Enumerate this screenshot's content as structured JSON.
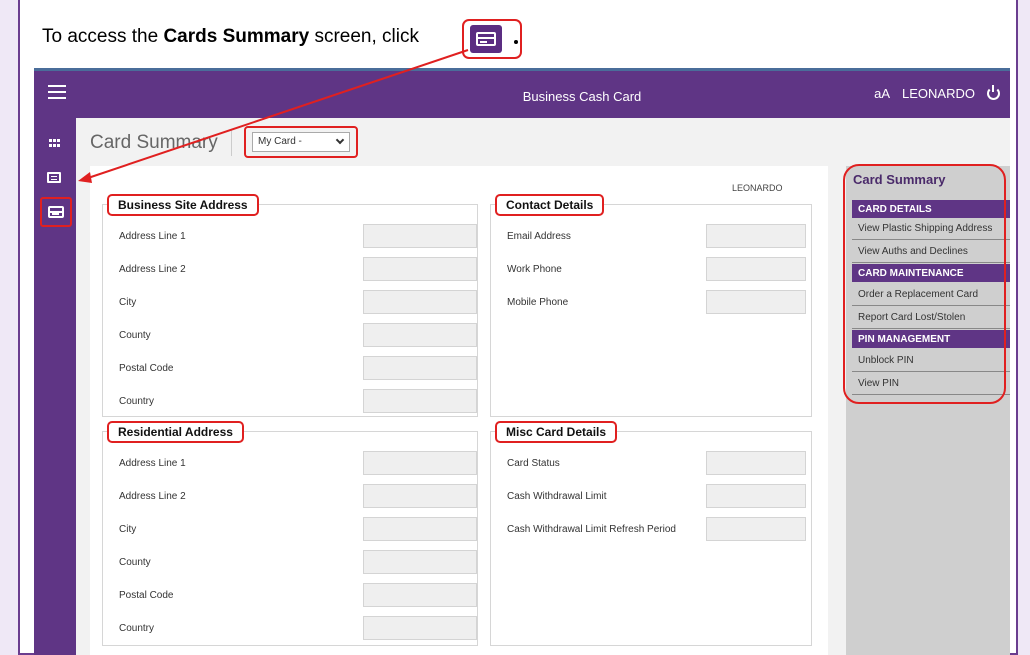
{
  "instruction": {
    "prefix": "To access the ",
    "bold": "Cards Summary",
    "suffix": " screen, click ",
    "icon": "credit-card-icon"
  },
  "topbar": {
    "app_title": "Business Cash Card",
    "font_toggle": "aA",
    "user_name": "LEONARDO",
    "menu_icon": "hamburger-icon",
    "logout_icon": "power-icon"
  },
  "leftnav": {
    "items": [
      {
        "icon": "grid-icon"
      },
      {
        "icon": "list-icon"
      },
      {
        "icon": "credit-card-icon"
      }
    ]
  },
  "page": {
    "title": "Card Summary",
    "card_select_value": "My Card -",
    "owner": "LEONARDO"
  },
  "business_address": {
    "title": "Business Site Address",
    "fields": [
      "Address Line 1",
      "Address Line 2",
      "City",
      "County",
      "Postal Code",
      "Country"
    ]
  },
  "contact_details": {
    "title": "Contact Details",
    "fields": [
      "Email Address",
      "Work Phone",
      "Mobile Phone"
    ]
  },
  "residential_address": {
    "title": "Residential Address",
    "fields": [
      "Address Line 1",
      "Address Line 2",
      "City",
      "County",
      "Postal Code",
      "Country"
    ]
  },
  "misc_card_details": {
    "title": "Misc Card Details",
    "fields": [
      "Card Status",
      "Cash Withdrawal Limit",
      "Cash Withdrawal Limit Refresh Period"
    ]
  },
  "side_menu": {
    "title": "Card Summary",
    "groups": [
      {
        "header": "CARD DETAILS",
        "items": [
          "View Plastic Shipping Address",
          "View Auths and Declines"
        ]
      },
      {
        "header": "CARD MAINTENANCE",
        "items": [
          "Order a Replacement Card",
          "Report Card Lost/Stolen"
        ]
      },
      {
        "header": "PIN MANAGEMENT",
        "items": [
          "Unblock PIN",
          "View PIN"
        ]
      }
    ]
  },
  "colors": {
    "brand_purple": "#5f3585",
    "highlight_red": "#e02020",
    "field_bg": "#efefef"
  }
}
